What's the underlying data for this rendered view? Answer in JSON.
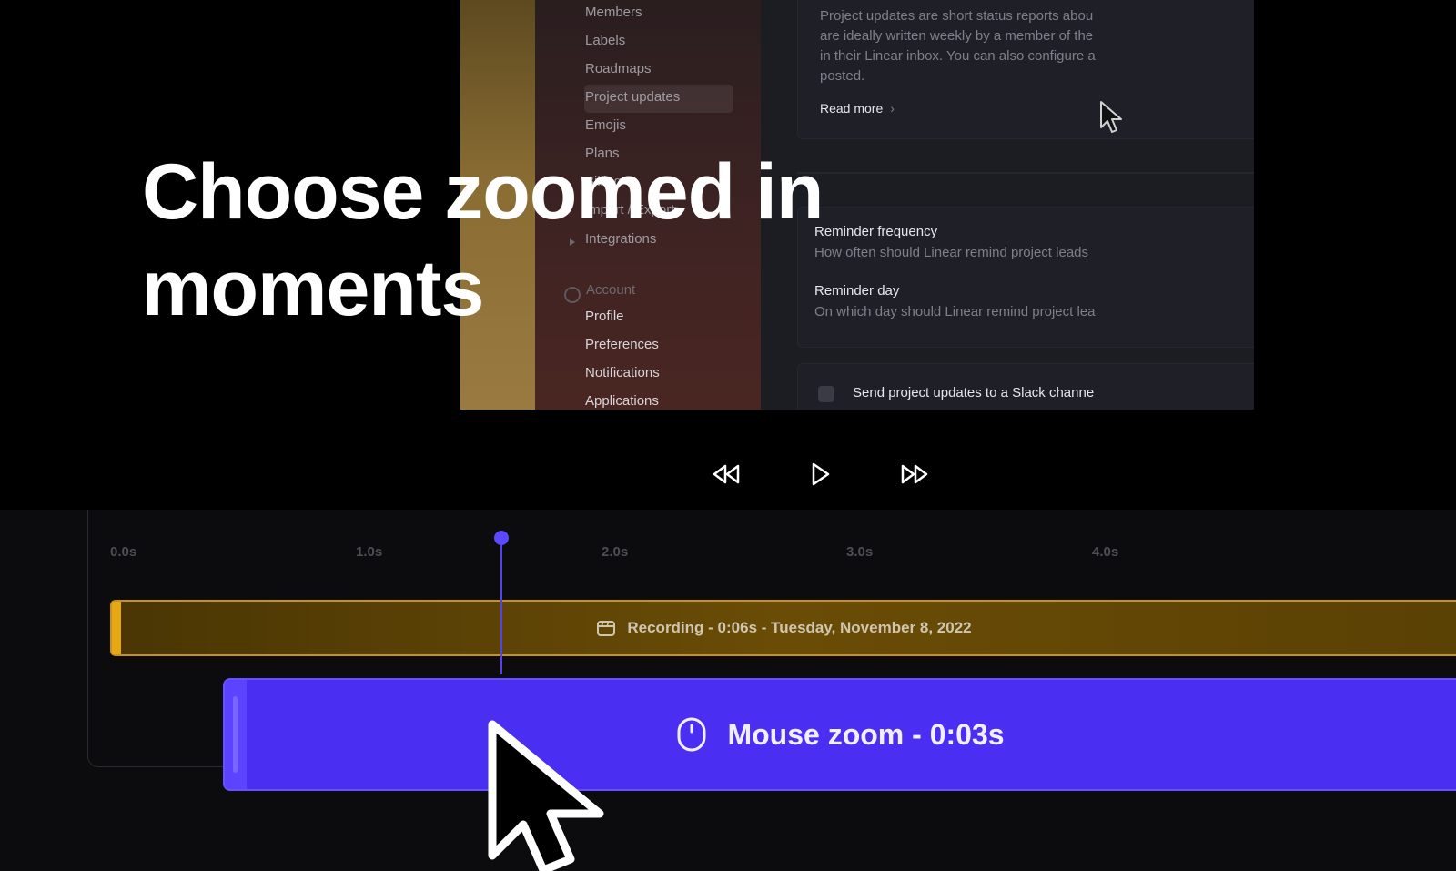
{
  "headline": "Choose zoomed in moments",
  "app": {
    "sidebar": {
      "items": [
        {
          "label": "Members"
        },
        {
          "label": "Labels"
        },
        {
          "label": "Roadmaps"
        },
        {
          "label": "Project updates"
        },
        {
          "label": "Emojis"
        },
        {
          "label": "Plans"
        },
        {
          "label": "Billing"
        },
        {
          "label": "Import / Export"
        },
        {
          "label": "Integrations"
        }
      ],
      "account_section": "Account",
      "account_items": [
        {
          "label": "Profile"
        },
        {
          "label": "Preferences"
        },
        {
          "label": "Notifications"
        },
        {
          "label": "Applications"
        }
      ]
    },
    "main": {
      "description_lines": [
        "Project updates are short status reports abou",
        "are ideally written weekly by a member of the",
        "in their Linear inbox. You can also configure a",
        "posted."
      ],
      "read_more": "Read more",
      "reminder_frequency_title": "Reminder frequency",
      "reminder_frequency_desc": "How often should Linear remind project leads",
      "reminder_day_title": "Reminder day",
      "reminder_day_desc": "On which day should Linear remind project lea",
      "slack_label": "Send project updates to a Slack channe"
    }
  },
  "controls": {
    "rewind_icon": "rewind-icon",
    "play_icon": "play-icon",
    "fast_forward_icon": "fast-forward-icon"
  },
  "timeline": {
    "ticks": [
      "0.0s",
      "1.0s",
      "2.0s",
      "3.0s",
      "4.0s"
    ],
    "playhead_seconds": 1.6,
    "recording_clip_label": "Recording - 0:06s - Tuesday, November 8, 2022",
    "zoom_clip_label": "Mouse zoom - 0:03s"
  },
  "colors": {
    "accent": "#4a2ef2",
    "recording_clip": "#6a4c06",
    "recording_handle": "#e8a812",
    "background": "#000000"
  }
}
